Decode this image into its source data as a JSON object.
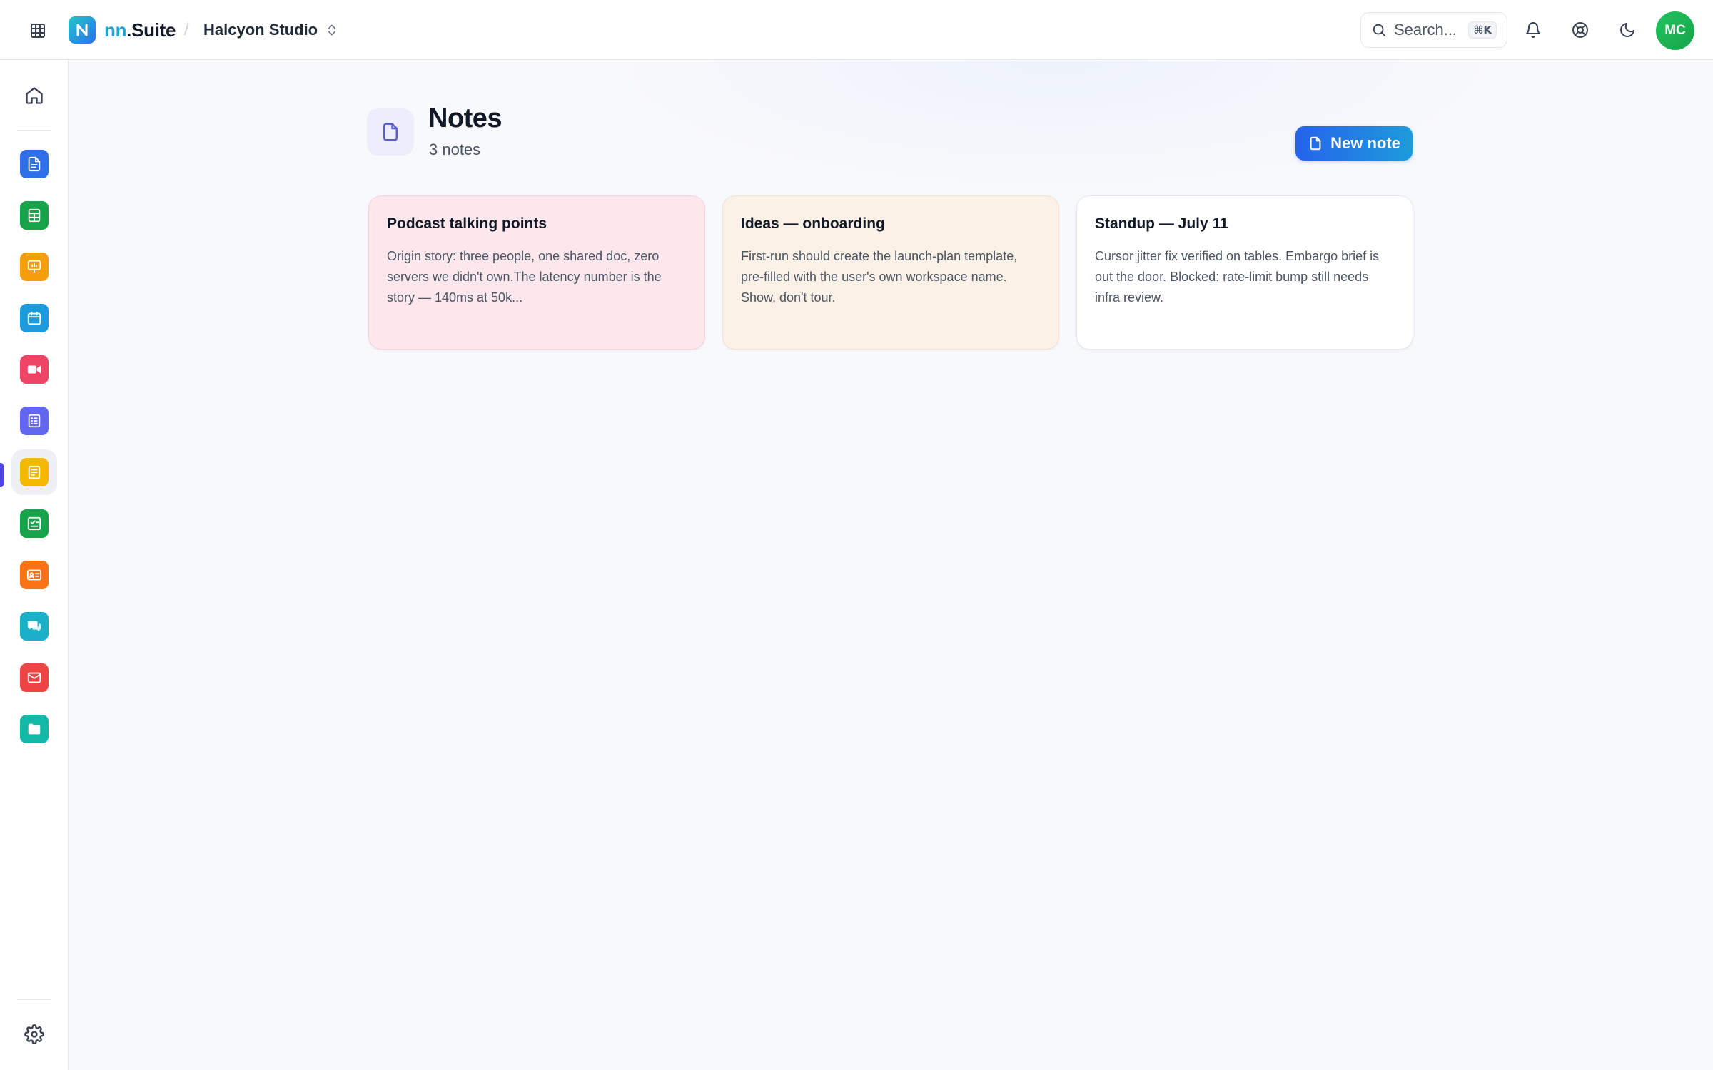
{
  "header": {
    "brand_prefix": "nn",
    "brand_suffix": ".Suite",
    "workspace": "Halcyon Studio",
    "search_placeholder": "Search...",
    "search_shortcut": "⌘K",
    "avatar_initials": "MC"
  },
  "sidebar": {
    "apps": [
      {
        "name": "docs",
        "color": "#2f6fe8",
        "icon": "document-icon"
      },
      {
        "name": "sheets",
        "color": "#16a34a",
        "icon": "spreadsheet-icon"
      },
      {
        "name": "slides",
        "color": "#f59e0b",
        "icon": "presentation-icon"
      },
      {
        "name": "calendar",
        "color": "#1e9bdc",
        "icon": "calendar-icon"
      },
      {
        "name": "meet",
        "color": "#ef4465",
        "icon": "video-icon"
      },
      {
        "name": "forms",
        "color": "#6366f1",
        "icon": "form-icon"
      },
      {
        "name": "notes",
        "color": "#f5b800",
        "icon": "note-icon"
      },
      {
        "name": "tasks",
        "color": "#16a34a",
        "icon": "tasks-icon"
      },
      {
        "name": "contacts",
        "color": "#f97316",
        "icon": "contact-card-icon"
      },
      {
        "name": "chat",
        "color": "#1ab0c8",
        "icon": "chat-icon"
      },
      {
        "name": "mail",
        "color": "#ef4444",
        "icon": "mail-icon"
      },
      {
        "name": "files",
        "color": "#14b8a6",
        "icon": "folder-icon"
      }
    ],
    "active_app": "notes"
  },
  "page": {
    "title": "Notes",
    "subtitle": "3 notes",
    "new_button": "New note"
  },
  "notes": [
    {
      "title": "Podcast talking points",
      "body": "Origin story: three people, one shared doc, zero servers we didn't own.The latency number is the story — 140ms at 50k...",
      "color": "#fce7ec",
      "border": "#f6d4dc"
    },
    {
      "title": "Ideas — onboarding",
      "body": "First-run should create the launch-plan template, pre-filled with the user's own workspace name. Show, don't tour.",
      "color": "#fcf1e6",
      "border": "#f3e2d0"
    },
    {
      "title": "Standup — July 11",
      "body": "Cursor jitter fix verified on tables. Embargo brief is out the door. Blocked: rate-limit bump still needs infra review.",
      "color": "#ffffff",
      "border": "#e5e7eb"
    }
  ]
}
